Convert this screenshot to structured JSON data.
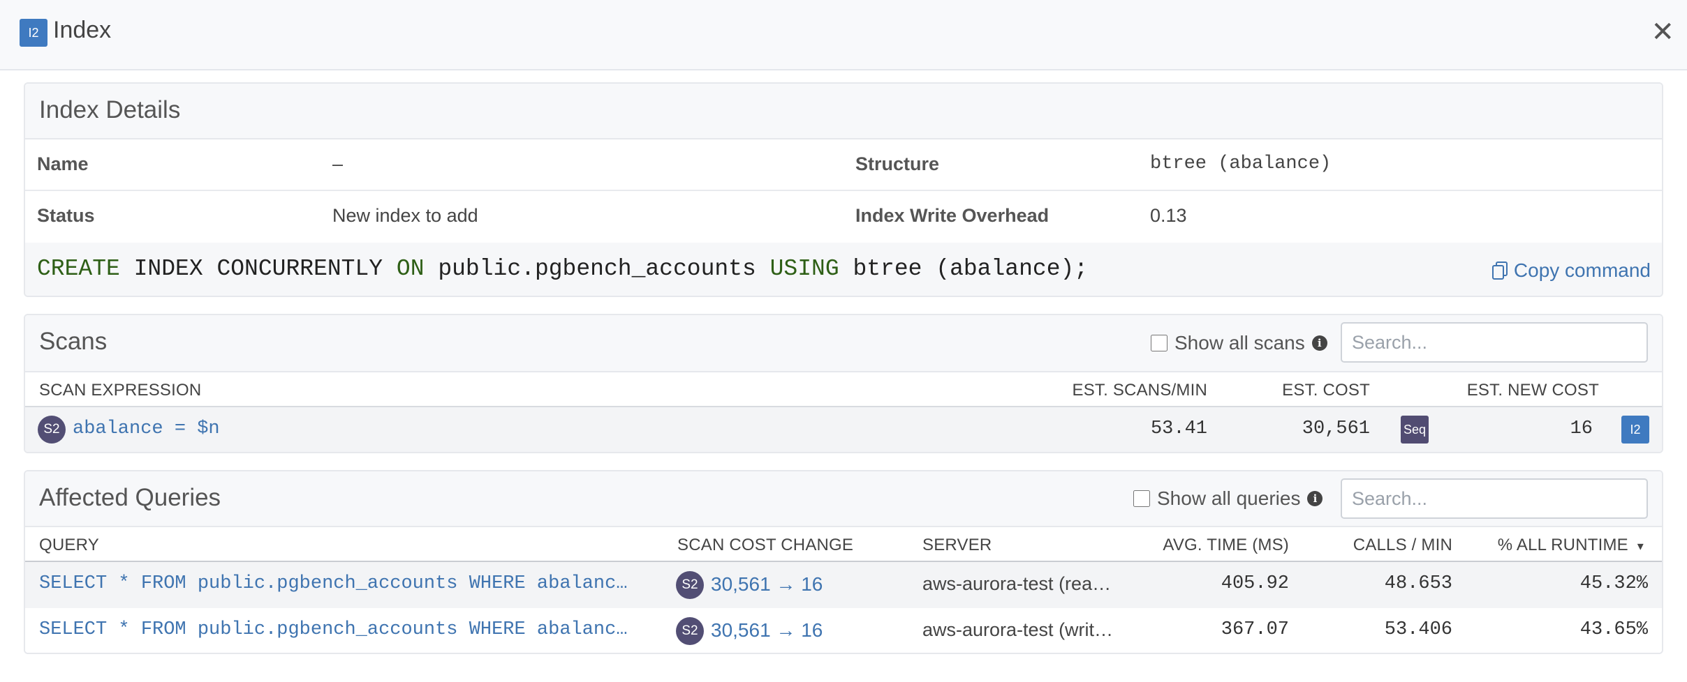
{
  "header": {
    "badge": "I2",
    "title": "Index",
    "close": "✕"
  },
  "details": {
    "title": "Index Details",
    "name_label": "Name",
    "name_value": "–",
    "structure_label": "Structure",
    "structure_value": "btree (abalance)",
    "status_label": "Status",
    "status_value": "New index to add",
    "overhead_label": "Index Write Overhead",
    "overhead_value": "0.13",
    "command": {
      "kw1": "CREATE",
      "t1": " INDEX CONCURRENTLY ",
      "kw2": "ON",
      "t2": " public.pgbench_accounts ",
      "kw3": "USING",
      "t3": " btree (abalance);"
    },
    "copy_label": "Copy command"
  },
  "scans": {
    "title": "Scans",
    "show_all": "Show all scans",
    "search_placeholder": "Search...",
    "columns": [
      "SCAN EXPRESSION",
      "EST. SCANS/MIN",
      "EST. COST",
      "EST. NEW COST"
    ],
    "rows": [
      {
        "badge": "S2",
        "expression": "abalance = $n",
        "scans_per_min": "53.41",
        "cost": "30,561",
        "cost_badge": "Seq",
        "new_cost": "16",
        "new_badge": "I2"
      }
    ]
  },
  "queries": {
    "title": "Affected Queries",
    "show_all": "Show all queries",
    "search_placeholder": "Search...",
    "columns": [
      "QUERY",
      "SCAN COST CHANGE",
      "SERVER",
      "AVG. TIME (MS)",
      "CALLS / MIN",
      "% ALL RUNTIME"
    ],
    "sort_indicator": "▾",
    "rows": [
      {
        "query": "SELECT * FROM public.pgbench_accounts WHERE abalanc…",
        "badge": "S2",
        "cost_change": "30,561 → 16",
        "server": "aws-aurora-test (rea…",
        "avg_time": "405.92",
        "calls": "48.653",
        "runtime": "45.32%"
      },
      {
        "query": "SELECT * FROM public.pgbench_accounts WHERE abalanc…",
        "badge": "S2",
        "cost_change": "30,561 → 16",
        "server": "aws-aurora-test (writ…",
        "avg_time": "367.07",
        "calls": "53.406",
        "runtime": "43.65%"
      }
    ]
  },
  "colors": {
    "accent": "#3f7ac0",
    "badge_dark": "#524e74",
    "keyword": "#2e5f16",
    "link": "#3f74b0"
  }
}
